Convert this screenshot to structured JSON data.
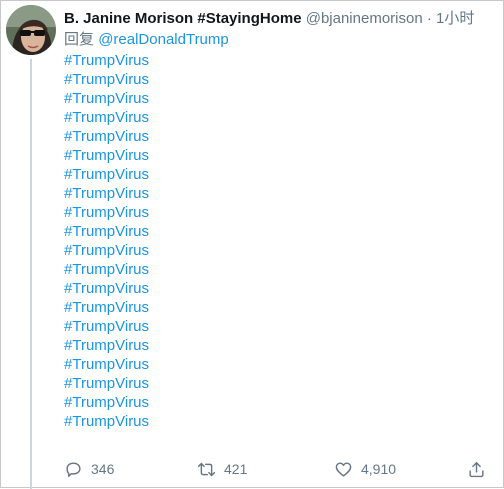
{
  "tweet": {
    "display_name": "B. Janine Morison #StayingHome",
    "handle": "@bjaninemorison",
    "separator": "·",
    "time": "1小时",
    "reply_label": "回复",
    "reply_to": "@realDonaldTrump",
    "hashtags": [
      "#TrumpVirus",
      "#TrumpVirus",
      "#TrumpVirus",
      "#TrumpVirus",
      "#TrumpVirus",
      "#TrumpVirus",
      "#TrumpVirus",
      "#TrumpVirus",
      "#TrumpVirus",
      "#TrumpVirus",
      "#TrumpVirus",
      "#TrumpVirus",
      "#TrumpVirus",
      "#TrumpVirus",
      "#TrumpVirus",
      "#TrumpVirus",
      "#TrumpVirus",
      "#TrumpVirus",
      "#TrumpVirus",
      "#TrumpVirus"
    ]
  },
  "actions": {
    "reply_icon": "reply-icon",
    "reply_count": "346",
    "retweet_icon": "retweet-icon",
    "retweet_count": "421",
    "like_icon": "heart-icon",
    "like_count": "4,910",
    "share_icon": "share-icon"
  },
  "colors": {
    "link": "#1b95e0",
    "secondary_text": "#657786",
    "primary_text": "#14171a",
    "thread_line": "#ccd6dd"
  }
}
